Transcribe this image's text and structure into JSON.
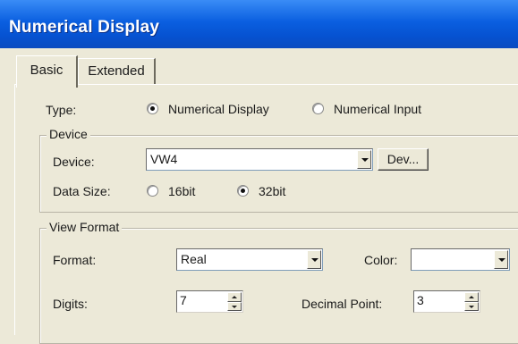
{
  "window": {
    "title": "Numerical Display"
  },
  "tabs": [
    {
      "label": "Basic"
    },
    {
      "label": "Extended"
    }
  ],
  "type": {
    "label": "Type:",
    "options": [
      {
        "label": "Numerical Display",
        "selected": true
      },
      {
        "label": "Numerical Input",
        "selected": false
      }
    ]
  },
  "device_group": {
    "title": "Device",
    "device_label": "Device:",
    "device_value": "VW4",
    "dev_button": "Dev...",
    "data_size_label": "Data Size:",
    "data_size_options": [
      {
        "label": "16bit",
        "selected": false
      },
      {
        "label": "32bit",
        "selected": true
      }
    ]
  },
  "view_format": {
    "title": "View Format",
    "format_label": "Format:",
    "format_value": "Real",
    "color_label": "Color:",
    "color_value": "#ffffff",
    "digits_label": "Digits:",
    "digits_value": "7",
    "decimal_label": "Decimal Point:",
    "decimal_value": "3"
  }
}
